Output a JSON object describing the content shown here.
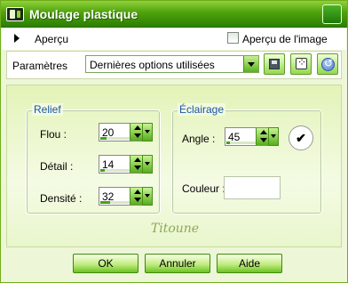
{
  "window": {
    "title": "Moulage plastique"
  },
  "preview": {
    "label": "Aperçu",
    "checkbox_label": "Aperçu de l'image",
    "checked": false
  },
  "params": {
    "label": "Paramètres",
    "preset_value": "Dernières options utilisées"
  },
  "relief": {
    "title": "Relief",
    "flou": {
      "label": "Flou :",
      "value": "20",
      "fill": 0.2
    },
    "detail": {
      "label": "Détail :",
      "value": "14",
      "fill": 0.14
    },
    "densite": {
      "label": "Densité :",
      "value": "32",
      "fill": 0.32
    }
  },
  "eclairage": {
    "title": "Éclairage",
    "angle": {
      "label": "Angle :",
      "value": "45",
      "fill": 0.125
    },
    "couleur": {
      "label": "Couleur :",
      "value": "#ffffff"
    }
  },
  "watermark": "Titoune",
  "buttons": {
    "ok": "OK",
    "cancel": "Annuler",
    "help": "Aide"
  },
  "colors": {
    "title_green": "#4fa20c",
    "accent_green": "#6cc41f",
    "group_title_blue": "#1b56a6"
  }
}
